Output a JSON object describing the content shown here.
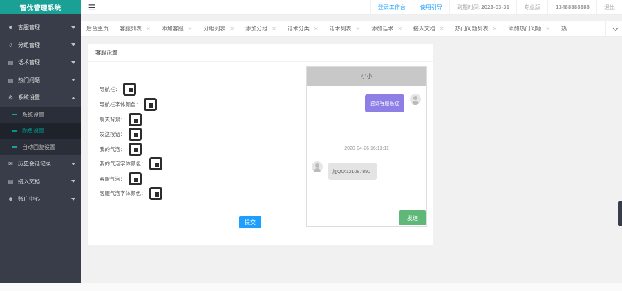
{
  "brand": "智优管理系统",
  "sidebar": {
    "items": [
      {
        "label": "客服管理",
        "icon": "user-icon"
      },
      {
        "label": "分组管理",
        "icon": "layers-icon"
      },
      {
        "label": "话术管理",
        "icon": "list-icon"
      },
      {
        "label": "热门问题",
        "icon": "list-icon"
      },
      {
        "label": "系统设置",
        "icon": "gear-icon"
      },
      {
        "label": "历史会话记录",
        "icon": "chat-icon"
      },
      {
        "label": "接入文档",
        "icon": "list-icon"
      },
      {
        "label": "账户中心",
        "icon": "user-icon"
      }
    ],
    "submenu": [
      "系统设置",
      "颜色设置",
      "自动回复设置"
    ]
  },
  "header": {
    "workbench": "登录工作台",
    "guide": "使用引导",
    "expire_label": "到期时间:",
    "expire_date": "2023-03-31",
    "edition": "专业版",
    "phone": "13488888888",
    "logout": "退出"
  },
  "tabs": [
    "后台主页",
    "客服列表",
    "添加客服",
    "分组列表",
    "添加分组",
    "话术分类",
    "话术列表",
    "添加话术",
    "接入文档",
    "热门问题列表",
    "添加热门问题",
    "热"
  ],
  "card": {
    "title": "客服设置",
    "fields": [
      "导航栏：",
      "导航栏字体颜色：",
      "聊天背景：",
      "发送按钮：",
      "我的气泡：",
      "我的气泡字体颜色：",
      "客服气泡：",
      "客服气泡字体颜色："
    ],
    "submit": "提交"
  },
  "chat": {
    "title": "小小",
    "my_message": "咨询客服系统",
    "timestamp": "2020-04-26 16:13:11",
    "service_message": "加QQ:121087890",
    "send": "发送"
  },
  "colors": {
    "sidebar_bg": "#393d49",
    "brand_bg": "#1aa094",
    "active": "#009688",
    "primary": "#1e9fff",
    "my_bubble": "#8d7fe6",
    "send_button": "#5fb878"
  }
}
